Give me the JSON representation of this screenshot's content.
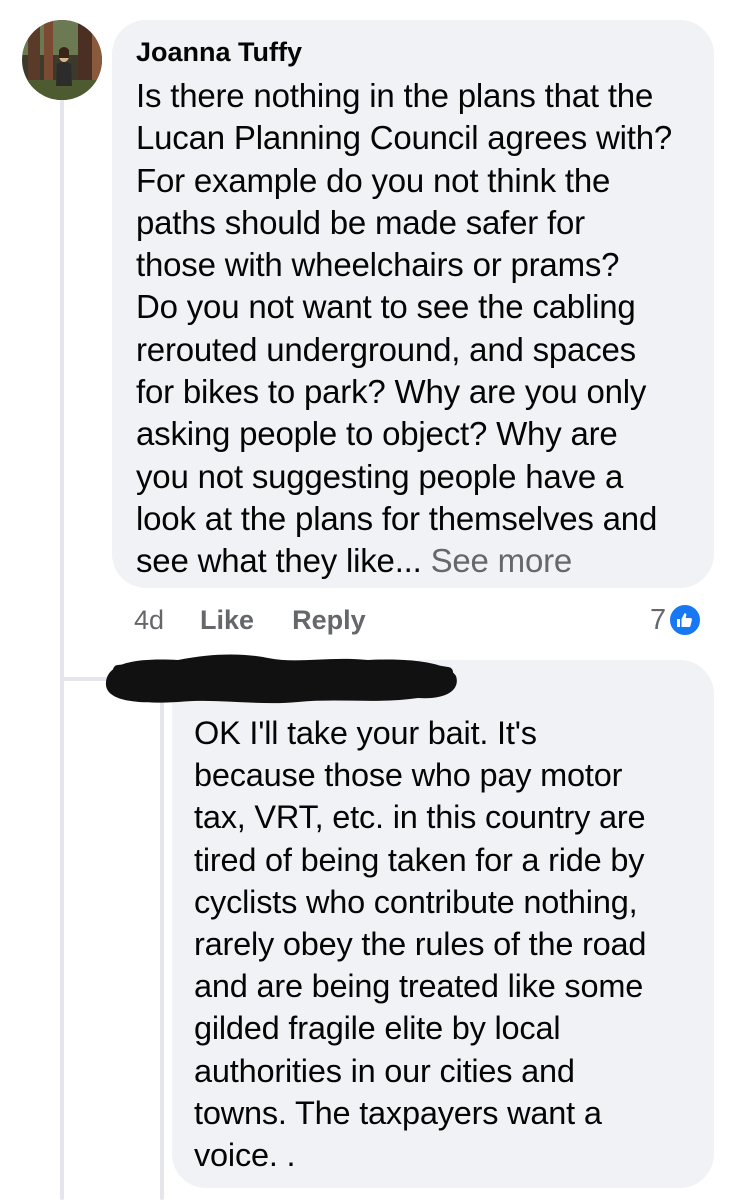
{
  "comment": {
    "author": "Joanna Tuffy",
    "avatar_icon": "profile-photo",
    "lines": [
      "Is there nothing in the plans that the",
      "Lucan Planning Council agrees with?",
      "For example do you not think the",
      "paths should be made safer for",
      "those with wheelchairs or prams?",
      "Do you not want to see the cabling",
      "rerouted underground, and spaces",
      "for bikes to park?  Why are you only",
      "asking people to object?  Why are",
      "you not suggesting people have a",
      "look at the plans for themselves and",
      "see what they like... "
    ],
    "see_more": "See more",
    "time": "4d",
    "like_label": "Like",
    "reply_label": "Reply",
    "reaction_count": "7",
    "reaction_icon": "thumbs-up-icon"
  },
  "reply": {
    "author_redacted": true,
    "lines": [
      "OK  I'll take your bait. It's",
      "because those who pay motor",
      "tax, VRT, etc. in this country are",
      "tired of being taken for a ride by",
      "cyclists who contribute nothing,",
      "rarely obey the rules of the road",
      "and are being treated like some",
      "gilded fragile elite by local",
      "authorities in our cities and",
      "towns. The taxpayers want a",
      "voice. ."
    ]
  },
  "colors": {
    "bubble": "#f0f2f5",
    "text": "#050505",
    "secondary": "#65676b",
    "like_blue": "#1877f2",
    "thread_line": "#e4e6eb"
  }
}
